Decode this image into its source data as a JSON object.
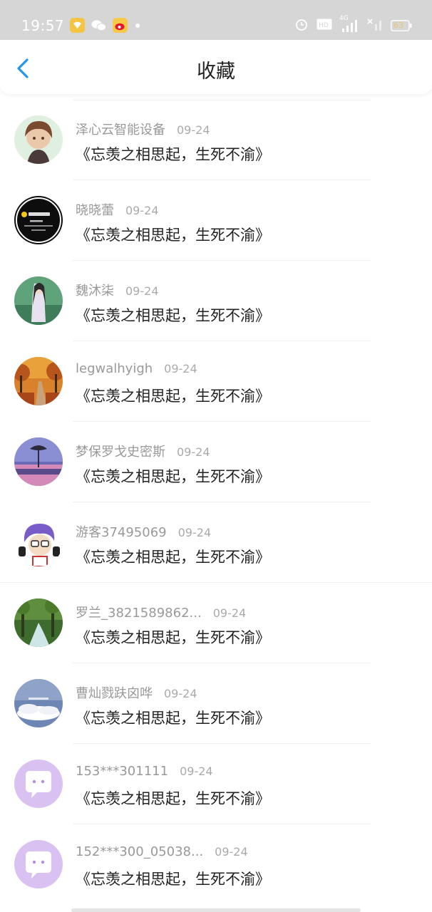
{
  "status_bar": {
    "time": "19:57",
    "network": "4G",
    "battery": "63"
  },
  "header": {
    "title": "收藏"
  },
  "items": [
    {
      "name": "泽心云智能设备",
      "date": "09-24",
      "text": "《忘羡之相思起，生死不渝》"
    },
    {
      "name": "晓晓蕾",
      "date": "09-24",
      "text": "《忘羡之相思起，生死不渝》"
    },
    {
      "name": "魏沐柒",
      "date": "09-24",
      "text": "《忘羡之相思起，生死不渝》"
    },
    {
      "name": "legwalhyigh",
      "date": "09-24",
      "text": "《忘羡之相思起，生死不渝》"
    },
    {
      "name": "梦保罗戈史密斯",
      "date": "09-24",
      "text": "《忘羡之相思起，生死不渝》"
    },
    {
      "name": "游客37495069",
      "date": "09-24",
      "text": "《忘羡之相思起，生死不渝》"
    },
    {
      "name": "罗兰_3821589862...",
      "date": "09-24",
      "text": "《忘羡之相思起，生死不渝》"
    },
    {
      "name": "曹灿戮趺囟哗",
      "date": "09-24",
      "text": "《忘羡之相思起，生死不渝》"
    },
    {
      "name": "153***301111",
      "date": "09-24",
      "text": "《忘羡之相思起，生死不渝》"
    },
    {
      "name": "152***300_05038...",
      "date": "09-24",
      "text": "《忘羡之相思起，生死不渝》"
    }
  ],
  "colors": {
    "accent": "#2196f3",
    "status_bar_bg": "#d6d6d6",
    "default_avatar": "#d9c2f2"
  }
}
